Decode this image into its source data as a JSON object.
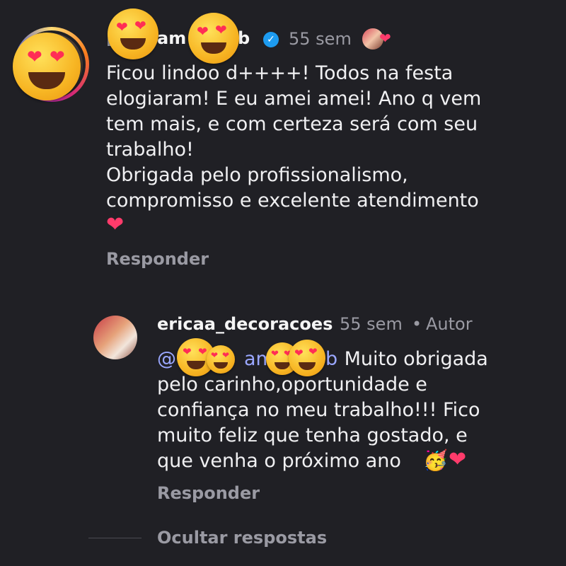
{
  "comment": {
    "username_visible_parts": [
      "am",
      "b"
    ],
    "verified": true,
    "time": "55 sem",
    "text": "Ficou lindoo d++++! Todos na festa\nelogiaram! E eu amei amei! Ano q vem\ntem mais, e com certeza será com seu\ntrabalho!\nObrigada pelo profissionalismo,\ncompromisso e excelente atendimento",
    "trailing_emoji": "❤",
    "reply_label": "Responder"
  },
  "reply": {
    "username": "ericaa_decoracoes",
    "time": "55 sem",
    "separator": "•",
    "author_badge": "Autor",
    "mention_parts": [
      "@",
      "am",
      "b"
    ],
    "text_after_mention": " Muito obrigada",
    "text": "pelo carinho,oportunidade e\nconfiança no meu trabalho!!! Fico\nmuito feliz que tenha gostado, e\nque venha o próximo ano",
    "trailing_emojis": [
      "🥳",
      "❤"
    ],
    "reply_label": "Responder"
  },
  "hide_replies_label": "Ocultar respostas",
  "icons": {
    "verified": "verified-badge-icon",
    "heart": "heart-icon",
    "overlay": "heart-eyes-emoji-sticker"
  },
  "colors": {
    "background": "#202025",
    "text": "#f0f0f2",
    "muted": "#9a9aa3",
    "mention": "#9aa7ff",
    "verified": "#1d9bf0",
    "heart": "#ff3b6b"
  }
}
